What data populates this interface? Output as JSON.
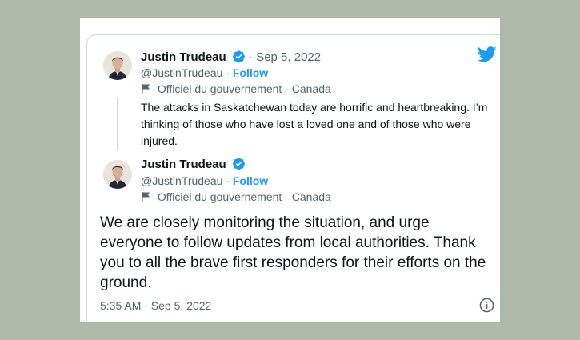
{
  "quoted_tweet": {
    "name": "Justin Trudeau",
    "date": "· Sep 5, 2022",
    "handle": "@JustinTrudeau ·",
    "follow": "Follow",
    "gov_label": "Officiel du gouvernement - Canada",
    "text": "The attacks in Saskatchewan today are horrific and heartbreaking. I’m thinking of those who have lost a loved one and of those who were injured."
  },
  "main_tweet": {
    "name": "Justin Trudeau",
    "handle": "@JustinTrudeau ·",
    "follow": "Follow",
    "gov_label": "Officiel du gouvernement - Canada",
    "text": "We are closely monitoring the situation, and urge everyone to follow updates from local authorities. Thank you to all the brave first responders for their efforts on the ground.",
    "timestamp": "5:35 AM · Sep 5, 2022"
  },
  "colors": {
    "accent": "#1d9bf0",
    "text": "#0f1419",
    "muted": "#536471",
    "background": "#b0b8aa"
  },
  "icons": [
    "twitter-bird-icon",
    "verified-badge-icon",
    "government-flag-icon",
    "info-icon"
  ]
}
